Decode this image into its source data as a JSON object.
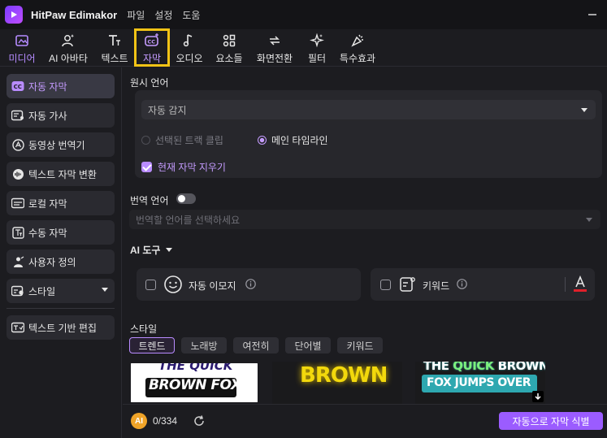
{
  "app": {
    "title": "HitPaw Edimakor",
    "menu": [
      "파일",
      "설정",
      "도움"
    ]
  },
  "toolbar": {
    "items": [
      {
        "label": "미디어",
        "icon": "media-icon"
      },
      {
        "label": "AI 아바타",
        "icon": "avatar-icon"
      },
      {
        "label": "텍스트",
        "icon": "text-icon"
      },
      {
        "label": "자막",
        "icon": "subtitle-icon"
      },
      {
        "label": "오디오",
        "icon": "audio-icon"
      },
      {
        "label": "요소들",
        "icon": "elements-icon"
      },
      {
        "label": "화면전환",
        "icon": "transition-icon"
      },
      {
        "label": "필터",
        "icon": "filter-icon"
      },
      {
        "label": "특수효과",
        "icon": "effects-icon"
      }
    ],
    "active": "자막",
    "highlight_color": "#f2c316"
  },
  "sidebar": {
    "items": [
      {
        "label": "자동 자막",
        "icon": "cc-icon",
        "active": true
      },
      {
        "label": "자동 가사",
        "icon": "lyrics-icon"
      },
      {
        "label": "동영상 번역기",
        "icon": "translate-icon"
      },
      {
        "label": "텍스트 자막 변환",
        "icon": "voice-icon"
      },
      {
        "label": "로컬 자막",
        "icon": "local-subtitle-icon"
      },
      {
        "label": "수동 자막",
        "icon": "manual-subtitle-icon"
      },
      {
        "label": "사용자 정의",
        "icon": "custom-icon"
      },
      {
        "label": "스타일",
        "icon": "style-icon"
      },
      {
        "label": "텍스트 기반 편집",
        "icon": "text-edit-icon"
      }
    ]
  },
  "main": {
    "source_language": {
      "label": "원시 언어",
      "value": "자동 감지",
      "radio_clip": "선택된 트랙 클립",
      "radio_main": "메인 타임라인",
      "checkbox_clear": "현재 자막 지우기"
    },
    "translate": {
      "label": "번역 언어",
      "placeholder": "번역할 언어를 선택하세요",
      "enabled": false
    },
    "ai_tools": {
      "label": "AI 도구",
      "auto_emoji": "자동 이모지",
      "keyword": "키워드"
    },
    "style": {
      "label": "스타일",
      "tabs": [
        "트렌드",
        "노래방",
        "여전히",
        "단어별",
        "키워드"
      ],
      "active_tab": "트렌드",
      "previews": [
        {
          "line1": "THE QUICK",
          "line2": "BROWN FOX"
        },
        {
          "line1": "BROWN",
          "line2": ""
        },
        {
          "line1a": "THE ",
          "line1b": "QUICK",
          "line1c": " BROWN",
          "line2": "FOX JUMPS OVER"
        }
      ]
    },
    "bottom": {
      "credits": "0/334",
      "ai_badge": "AI",
      "primary_button": "자동으로 자막 식별"
    }
  },
  "colors": {
    "accent": "#9b5cff",
    "accent_text": "#c59cff",
    "background": "#1c1c20"
  }
}
